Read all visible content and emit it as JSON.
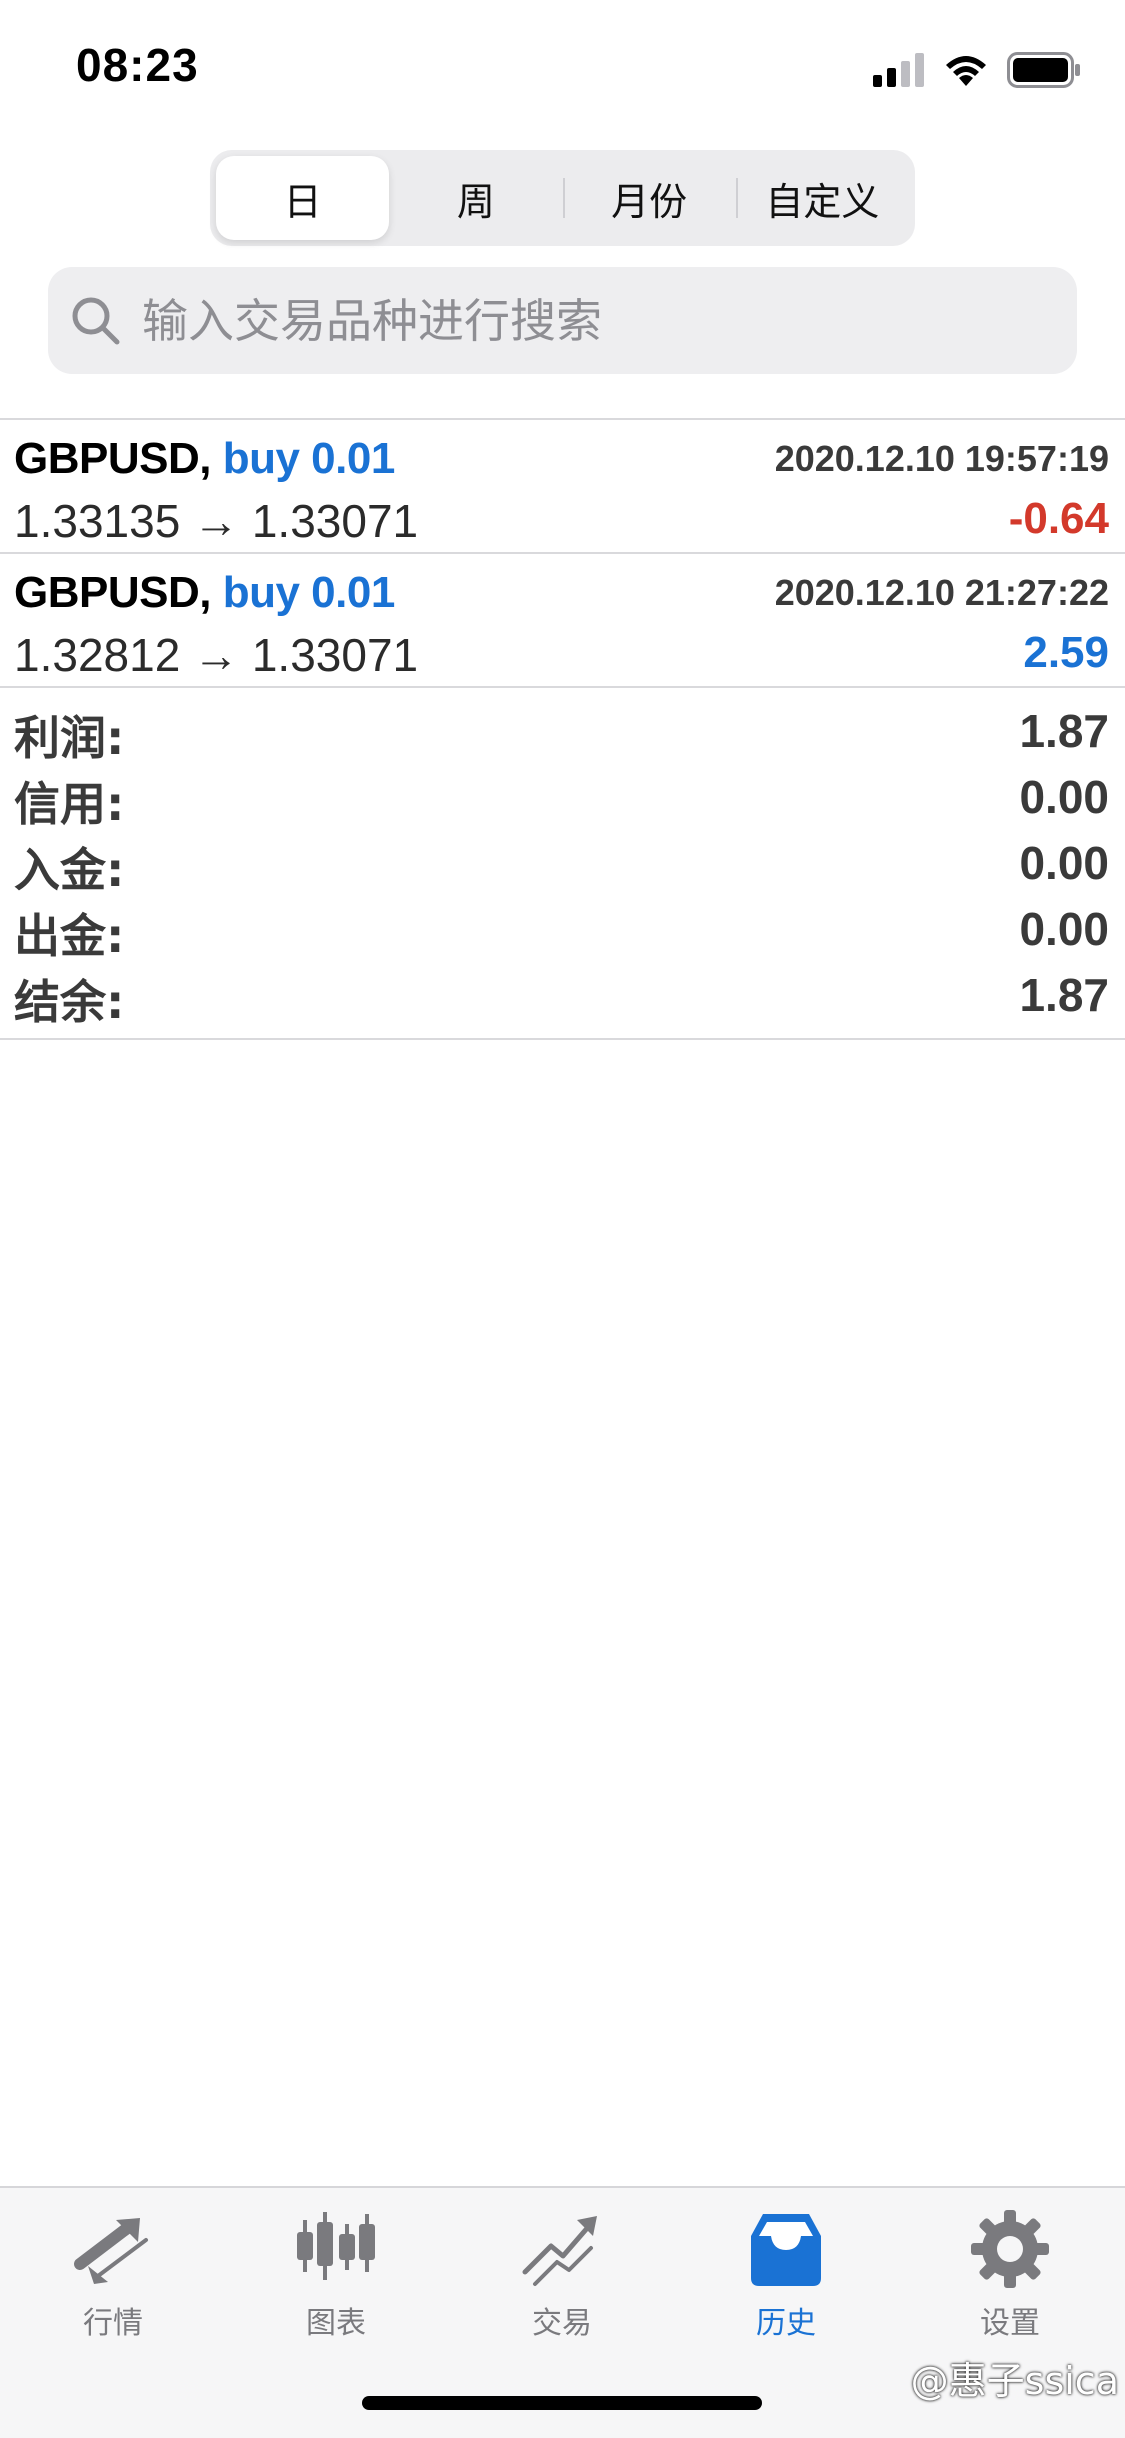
{
  "status_bar": {
    "time": "08:23"
  },
  "period_tabs": [
    {
      "label": "日",
      "active": true
    },
    {
      "label": "周",
      "active": false
    },
    {
      "label": "月份",
      "active": false
    },
    {
      "label": "自定义",
      "active": false
    }
  ],
  "search": {
    "placeholder": "输入交易品种进行搜索",
    "icon": "search-icon"
  },
  "deals": [
    {
      "symbol": "GBPUSD,",
      "type_volume": "buy 0.01",
      "time": "2020.12.10 19:57:19",
      "prices": "1.33135 → 1.33071",
      "profit": "-0.64"
    },
    {
      "symbol": "GBPUSD,",
      "type_volume": "buy 0.01",
      "time": "2020.12.10 21:27:22",
      "prices": "1.32812 → 1.33071",
      "profit": "2.59"
    }
  ],
  "summary": [
    {
      "label": "利润:",
      "value": "1.87"
    },
    {
      "label": "信用:",
      "value": "0.00"
    },
    {
      "label": "入金:",
      "value": "0.00"
    },
    {
      "label": "出金:",
      "value": "0.00"
    },
    {
      "label": "结余:",
      "value": "1.87"
    }
  ],
  "tab_bar": [
    {
      "label": "行情",
      "icon": "quotes-icon",
      "active": false
    },
    {
      "label": "图表",
      "icon": "chart-icon",
      "active": false
    },
    {
      "label": "交易",
      "icon": "trade-icon",
      "active": false
    },
    {
      "label": "历史",
      "icon": "history-icon",
      "active": true
    },
    {
      "label": "设置",
      "icon": "settings-icon",
      "active": false
    }
  ],
  "watermark": "@惠子ssica",
  "colors": {
    "accent": "#1a72d4",
    "loss": "#d3392b",
    "inactive": "#7a7a7e"
  }
}
